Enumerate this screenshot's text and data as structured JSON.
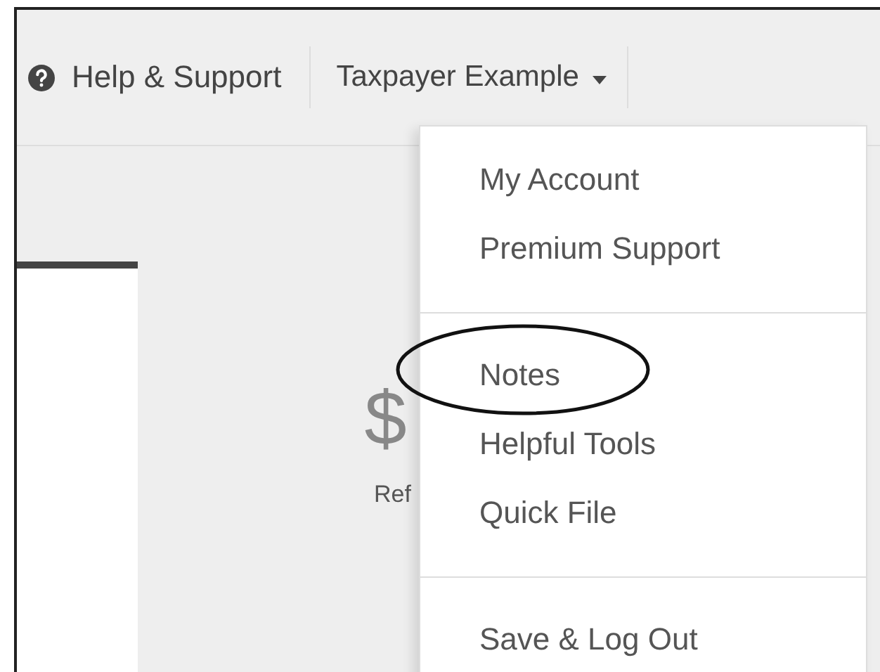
{
  "header": {
    "help_link": {
      "label": "Help & Support"
    },
    "account_menu": {
      "label": "Taxpayer Example"
    }
  },
  "refund_tile": {
    "icon": "$",
    "label": "Ref"
  },
  "dropdown": {
    "groups": [
      {
        "items": [
          {
            "label": "My Account",
            "annotated": false
          },
          {
            "label": "Premium Support",
            "annotated": false
          }
        ]
      },
      {
        "items": [
          {
            "label": "Notes",
            "annotated": true
          },
          {
            "label": "Helpful Tools",
            "annotated": false
          },
          {
            "label": "Quick File",
            "annotated": false
          }
        ]
      },
      {
        "items": [
          {
            "label": "Save & Log Out",
            "annotated": false
          }
        ]
      }
    ]
  }
}
